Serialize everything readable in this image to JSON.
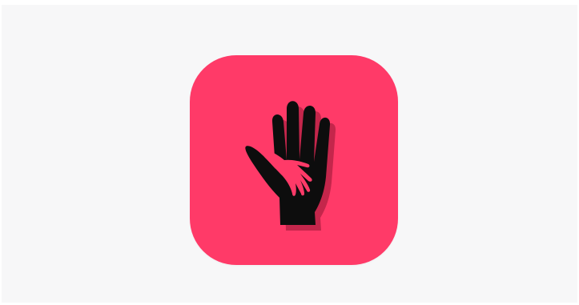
{
  "page": {
    "background_color": "#f7f7f8"
  },
  "app_icon": {
    "icon_name": "helping-hand-icon",
    "tile_color": "#ff3a68",
    "hand_color": "#0d0d0d",
    "hand_shadow_color": "#c4264b",
    "small_hand_color": "#ff3a68"
  }
}
